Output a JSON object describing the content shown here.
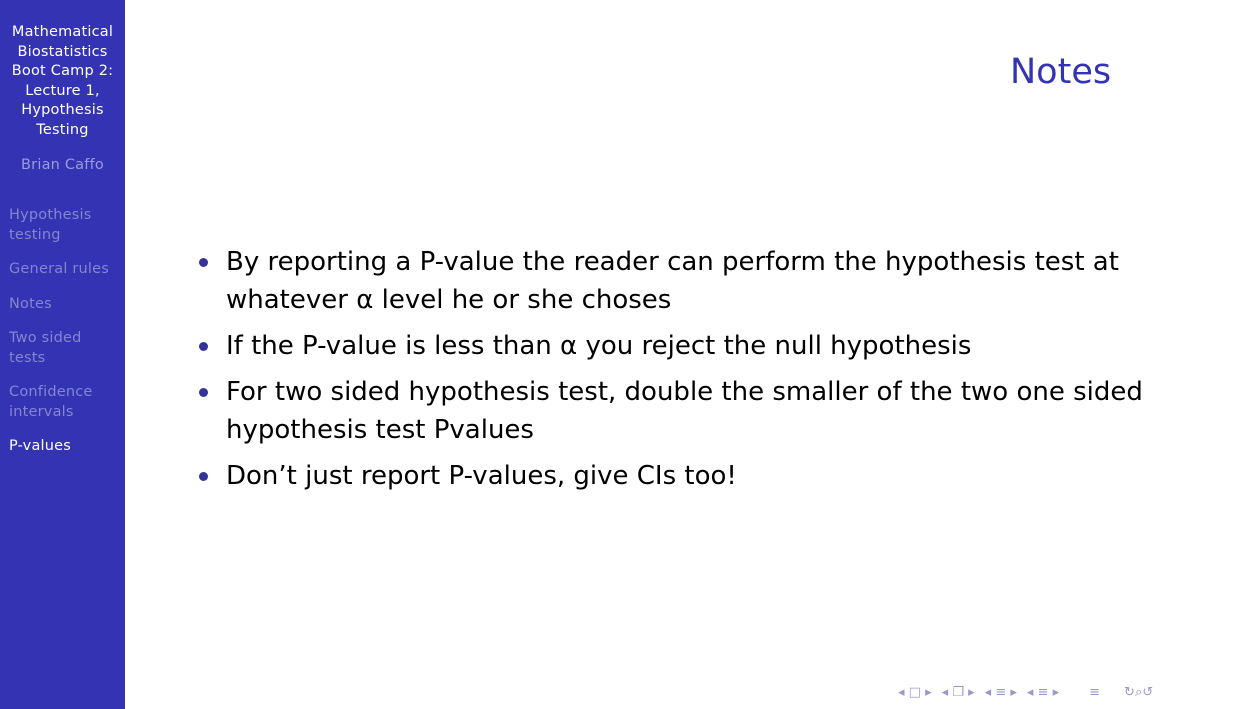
{
  "sidebar": {
    "title": "Mathematical\nBiostatistics\nBoot Camp 2:\nLecture 1,\nHypothesis\nTesting",
    "author": "Brian Caffo",
    "nav": [
      {
        "label": "Hypothesis\ntesting",
        "current": false
      },
      {
        "label": "General rules",
        "current": false
      },
      {
        "label": "Notes",
        "current": false
      },
      {
        "label": "Two sided\ntests",
        "current": false
      },
      {
        "label": "Confidence\nintervals",
        "current": false
      },
      {
        "label": "P-values",
        "current": true
      }
    ]
  },
  "slide": {
    "title": "Notes",
    "bullets": [
      "By reporting a P-value the reader can perform the hypothesis test at whatever α level he or she choses",
      "If the P-value is less than α you reject the null hypothesis",
      "For two sided hypothesis test, double the smaller of the two one sided hypothesis test Pvalues",
      "Don’t just report P-values, give CIs too!"
    ]
  },
  "navbar": {
    "frame_prev": "◂",
    "frame": "□",
    "frame_next": "▸",
    "subsection_prev": "◂",
    "subsection": "❐",
    "subsection_next": "▸",
    "section_prev": "◂",
    "section": "≡",
    "section_next": "▸",
    "doc_prev": "◂",
    "doc": "≡",
    "doc_next": "▸",
    "appendix": "≡",
    "search": "↻⌕↺"
  },
  "colors": {
    "sidebar_bg": "#3333b3",
    "title": "#3333b3",
    "bullet": "#333399",
    "nav_inactive": "#8585d1",
    "navbar": "#9999cc"
  }
}
